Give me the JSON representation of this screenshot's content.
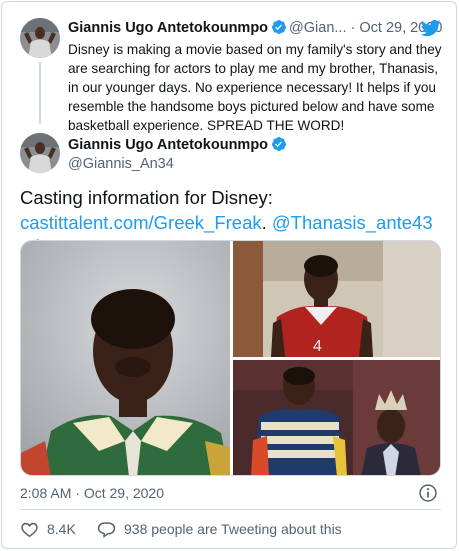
{
  "quoted": {
    "author_name": "Giannis Ugo Antetokounmpo",
    "handle": "@Gian...",
    "separator": "·",
    "date": "Oct 29, 2020",
    "text": "Disney is making a movie based on my family's story and they are searching for actors to play me and my brother, Thanasis, in our younger days. No experience necessary! It helps if you resemble the handsome boys pictured below and have some basketball experience. SPREAD THE WORD!"
  },
  "main": {
    "author_name": "Giannis Ugo Antetokounmpo",
    "handle": "@Giannis_An34",
    "text_line1": "Casting information for Disney:",
    "link_url": "castittalent.com/Greek_Freak",
    "text_mid": ". ",
    "mention": "@Thanasis_ante43",
    "emoji": "flexed-biceps"
  },
  "footer": {
    "time": "2:08 AM",
    "separator": "·",
    "date": "Oct 29, 2020",
    "likes": "8.4K",
    "talk_text": "938 people are Tweeting about this"
  },
  "colors": {
    "accent": "#1d9bf0",
    "text": "#0f1419",
    "muted": "#536471",
    "border": "#cfd9de"
  },
  "icons": [
    "verified-badge-icon",
    "twitter-bird-icon",
    "info-icon",
    "heart-icon",
    "speech-bubble-icon",
    "flexed-biceps-emoji"
  ]
}
